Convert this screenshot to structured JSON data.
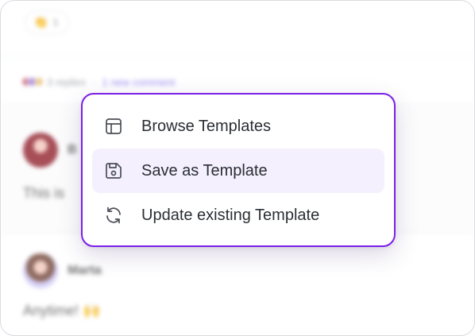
{
  "reactions": {
    "emoji": "👏",
    "count": "1"
  },
  "thread": {
    "replies_label": "3 replies",
    "separator": "·",
    "new_comment_label": "1 new comment",
    "comments": [
      {
        "author": "B",
        "text": "This is"
      },
      {
        "author": "Marta",
        "text": "Anytime! 🙌"
      }
    ]
  },
  "menu": {
    "items": [
      {
        "label": "Browse Templates",
        "icon": "layout-template-icon"
      },
      {
        "label": "Save as Template",
        "icon": "save-icon"
      },
      {
        "label": "Update existing Template",
        "icon": "refresh-icon"
      }
    ],
    "active_index": 1,
    "accent_color": "#7b1fe6",
    "active_bg": "#f4f0fd"
  }
}
